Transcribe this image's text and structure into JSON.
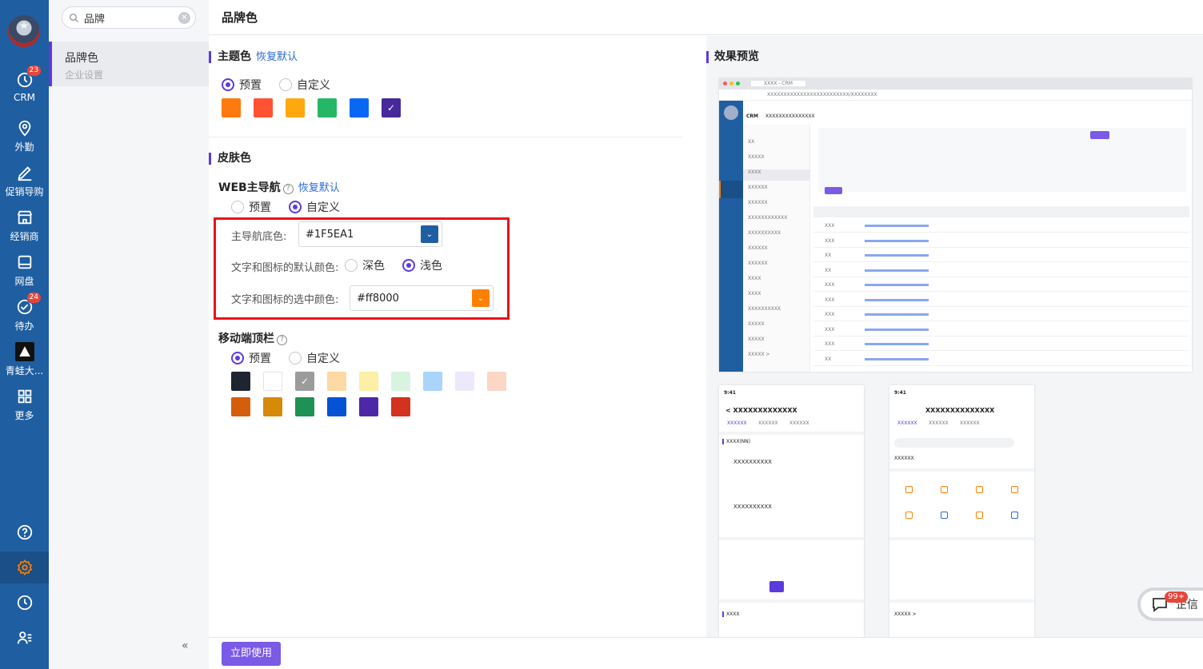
{
  "nav": {
    "items": [
      {
        "label": "CRM",
        "badge": "23"
      },
      {
        "label": "外勤"
      },
      {
        "label": "促销导购"
      },
      {
        "label": "经销商"
      },
      {
        "label": "网盘"
      },
      {
        "label": "待办",
        "badge": "24"
      },
      {
        "label": "青蛙大..."
      },
      {
        "label": "更多"
      }
    ]
  },
  "sidebar": {
    "search_value": "品牌",
    "item_title": "品牌色",
    "item_subtitle": "企业设置",
    "collapse": "«"
  },
  "header": {
    "title": "品牌色"
  },
  "theme": {
    "title": "主题色",
    "reset": "恢复默认",
    "opt_preset": "预置",
    "opt_custom": "自定义",
    "swatches": [
      "#FF7A0E",
      "#FF5233",
      "#FFA90C",
      "#26B766",
      "#0A67F5",
      "#46299B"
    ]
  },
  "skin": {
    "title": "皮肤色",
    "web_nav": {
      "title": "WEB主导航",
      "reset": "恢复默认",
      "opt_preset": "预置",
      "opt_custom": "自定义",
      "bg_label": "主导航底色:",
      "bg_value": "#1F5EA1",
      "default_color_label": "文字和图标的默认颜色:",
      "opt_dark": "深色",
      "opt_light": "浅色",
      "selected_color_label": "文字和图标的选中颜色:",
      "selected_value": "#ff8000"
    },
    "mobile": {
      "title": "移动端顶栏",
      "opt_preset": "预置",
      "opt_custom": "自定义",
      "row1": [
        "#1E2430",
        "#FFFFFF",
        "#9B9B9B",
        "#FDD9A3",
        "#FCEFA6",
        "#D8F4E1",
        "#A9D5FB",
        "#EEE8FB",
        "#FCD7C5"
      ],
      "row2": [
        "#D45E0C",
        "#D68A0A",
        "#1F9154",
        "#0652D4",
        "#4C28A8",
        "#D3321E"
      ]
    }
  },
  "preview": {
    "title": "效果预览",
    "web": {
      "tab": "XXXX - CRM",
      "url": "XXXXXXXXXXXXXXXXXXXXXXXXX/XXXXXXXX",
      "app": "CRM",
      "app_title": "XXXXXXXXXXXXXXX",
      "left_items": [
        "XX",
        "XXXXX",
        "XXXX",
        "XXXXXX",
        "XXXXXX",
        "XXXXXXXXXXXX",
        "XXXXXXXXXX",
        "XXXXXX",
        "XXXXXX",
        "XXXX",
        "XXXX",
        "XXXXXXXXXX",
        "XXXXX",
        "XXXXX",
        "XXXXX >"
      ],
      "row_labels": [
        "XXX",
        "XXX",
        "XX",
        "XX",
        "XXX",
        "XXX",
        "XXX",
        "XXX",
        "XXX",
        "XX"
      ]
    },
    "mobile_left": {
      "time": "9:41",
      "title": "XXXXXXXXXXXXX",
      "tabs": [
        "XXXXXX",
        "XXXXXX",
        "XXXXXX"
      ],
      "section": "XXXX(NN)",
      "card": "XXXXXXXXXX",
      "bottom": "XXXX"
    },
    "mobile_right": {
      "time": "9:41",
      "title": "XXXXXXXXXXXXXX",
      "tabs": [
        "XXXXXX",
        "XXXXXX",
        "XXXXXX"
      ],
      "section": "XXXXXX",
      "bottom": "XXXXX >"
    }
  },
  "footer": {
    "apply": "立即使用"
  },
  "chat": {
    "badge": "99+",
    "label": "企信"
  }
}
